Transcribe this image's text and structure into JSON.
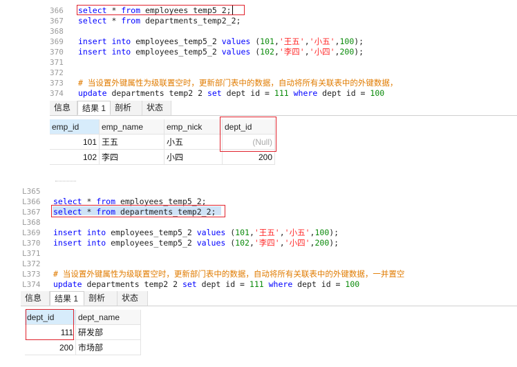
{
  "top_editor": {
    "lines": [
      {
        "num": "366",
        "tokens": [
          [
            "kw",
            "select"
          ],
          [
            "fn",
            " * "
          ],
          [
            "kw",
            "from"
          ],
          [
            "fn",
            " employees_temp5_2;"
          ]
        ]
      },
      {
        "num": "367",
        "tokens": [
          [
            "kw",
            "select"
          ],
          [
            "fn",
            " * "
          ],
          [
            "kw",
            "from"
          ],
          [
            "fn",
            " departments_temp2_2;"
          ]
        ]
      },
      {
        "num": "368",
        "tokens": []
      },
      {
        "num": "369",
        "tokens": [
          [
            "kw",
            "insert"
          ],
          [
            "fn",
            " "
          ],
          [
            "kw",
            "into"
          ],
          [
            "fn",
            " employees_temp5_2 "
          ],
          [
            "kw",
            "values"
          ],
          [
            "fn",
            " ("
          ],
          [
            "num",
            "101"
          ],
          [
            "fn",
            ","
          ],
          [
            "str",
            "'王五'"
          ],
          [
            "fn",
            ","
          ],
          [
            "str",
            "'小五'"
          ],
          [
            "fn",
            ","
          ],
          [
            "num",
            "100"
          ],
          [
            "fn",
            ");"
          ]
        ]
      },
      {
        "num": "370",
        "tokens": [
          [
            "kw",
            "insert"
          ],
          [
            "fn",
            " "
          ],
          [
            "kw",
            "into"
          ],
          [
            "fn",
            " employees_temp5_2 "
          ],
          [
            "kw",
            "values"
          ],
          [
            "fn",
            " ("
          ],
          [
            "num",
            "102"
          ],
          [
            "fn",
            ","
          ],
          [
            "str",
            "'李四'"
          ],
          [
            "fn",
            ","
          ],
          [
            "str",
            "'小四'"
          ],
          [
            "fn",
            ","
          ],
          [
            "num",
            "200"
          ],
          [
            "fn",
            ");"
          ]
        ]
      },
      {
        "num": "371",
        "tokens": []
      },
      {
        "num": "372",
        "tokens": []
      },
      {
        "num": "373",
        "tokens": [
          [
            "cmt",
            "# 当设置外键属性为级联置空时，更新部门表中的数据，自动将所有关联表中的外键数据，"
          ]
        ]
      },
      {
        "num": "374",
        "tokens": [
          [
            "kw",
            "update"
          ],
          [
            "fn",
            " departments temp2 2 "
          ],
          [
            "kw",
            "set"
          ],
          [
            "fn",
            " dept id = "
          ],
          [
            "num",
            "111"
          ],
          [
            "fn",
            " "
          ],
          [
            "kw",
            "where"
          ],
          [
            "fn",
            " dept id = "
          ],
          [
            "num",
            "100"
          ]
        ]
      }
    ],
    "tabs": [
      "信息",
      "结果 1",
      "剖析",
      "状态"
    ],
    "columns": [
      "emp_id",
      "emp_name",
      "emp_nick",
      "dept_id"
    ],
    "rows": [
      [
        "101",
        "王五",
        "小五",
        "(Null)"
      ],
      [
        "102",
        "李四",
        "小四",
        "200"
      ]
    ]
  },
  "bottom_editor": {
    "lines": [
      {
        "num": "L365",
        "tokens": []
      },
      {
        "num": "L366",
        "tokens": [
          [
            "kw",
            "select"
          ],
          [
            "fn",
            " * "
          ],
          [
            "kw",
            "from"
          ],
          [
            "fn",
            " employees_temp5_2;"
          ]
        ]
      },
      {
        "num": "L367",
        "tokens": [
          [
            "kw",
            "select"
          ],
          [
            "fn",
            " * "
          ],
          [
            "kw",
            "from"
          ],
          [
            "fn",
            " departments_temp2_2;"
          ]
        ]
      },
      {
        "num": "L368",
        "tokens": []
      },
      {
        "num": "L369",
        "tokens": [
          [
            "kw",
            "insert"
          ],
          [
            "fn",
            " "
          ],
          [
            "kw",
            "into"
          ],
          [
            "fn",
            " employees_temp5_2 "
          ],
          [
            "kw",
            "values"
          ],
          [
            "fn",
            " ("
          ],
          [
            "num",
            "101"
          ],
          [
            "fn",
            ","
          ],
          [
            "str",
            "'王五'"
          ],
          [
            "fn",
            ","
          ],
          [
            "str",
            "'小五'"
          ],
          [
            "fn",
            ","
          ],
          [
            "num",
            "100"
          ],
          [
            "fn",
            ");"
          ]
        ]
      },
      {
        "num": "L370",
        "tokens": [
          [
            "kw",
            "insert"
          ],
          [
            "fn",
            " "
          ],
          [
            "kw",
            "into"
          ],
          [
            "fn",
            " employees_temp5_2 "
          ],
          [
            "kw",
            "values"
          ],
          [
            "fn",
            " ("
          ],
          [
            "num",
            "102"
          ],
          [
            "fn",
            ","
          ],
          [
            "str",
            "'李四'"
          ],
          [
            "fn",
            ","
          ],
          [
            "str",
            "'小四'"
          ],
          [
            "fn",
            ","
          ],
          [
            "num",
            "200"
          ],
          [
            "fn",
            ");"
          ]
        ]
      },
      {
        "num": "L371",
        "tokens": []
      },
      {
        "num": "L372",
        "tokens": []
      },
      {
        "num": "L373",
        "tokens": [
          [
            "cmt",
            "# 当设置外键属性为级联置空时，更新部门表中的数据，自动将所有关联表中的外键数据，一并置空"
          ]
        ]
      },
      {
        "num": "L374",
        "tokens": [
          [
            "kw",
            "update"
          ],
          [
            "fn",
            " departments temp2 2 "
          ],
          [
            "kw",
            "set"
          ],
          [
            "fn",
            " dept id = "
          ],
          [
            "num",
            "111"
          ],
          [
            "fn",
            " "
          ],
          [
            "kw",
            "where"
          ],
          [
            "fn",
            " dept id = "
          ],
          [
            "num",
            "100"
          ]
        ]
      }
    ],
    "tabs": [
      "信息",
      "结果 1",
      "剖析",
      "状态"
    ],
    "columns": [
      "dept_id",
      "dept_name"
    ],
    "rows": [
      [
        "111",
        "研发部"
      ],
      [
        "200",
        "市场部"
      ]
    ]
  },
  "colors": {
    "keyword": "#0000ff",
    "string": "#ff2a2a",
    "number": "#0a8a0a",
    "comment": "#e07b00",
    "highlight_box": "#e0202a",
    "selection": "#cfe3f7"
  }
}
